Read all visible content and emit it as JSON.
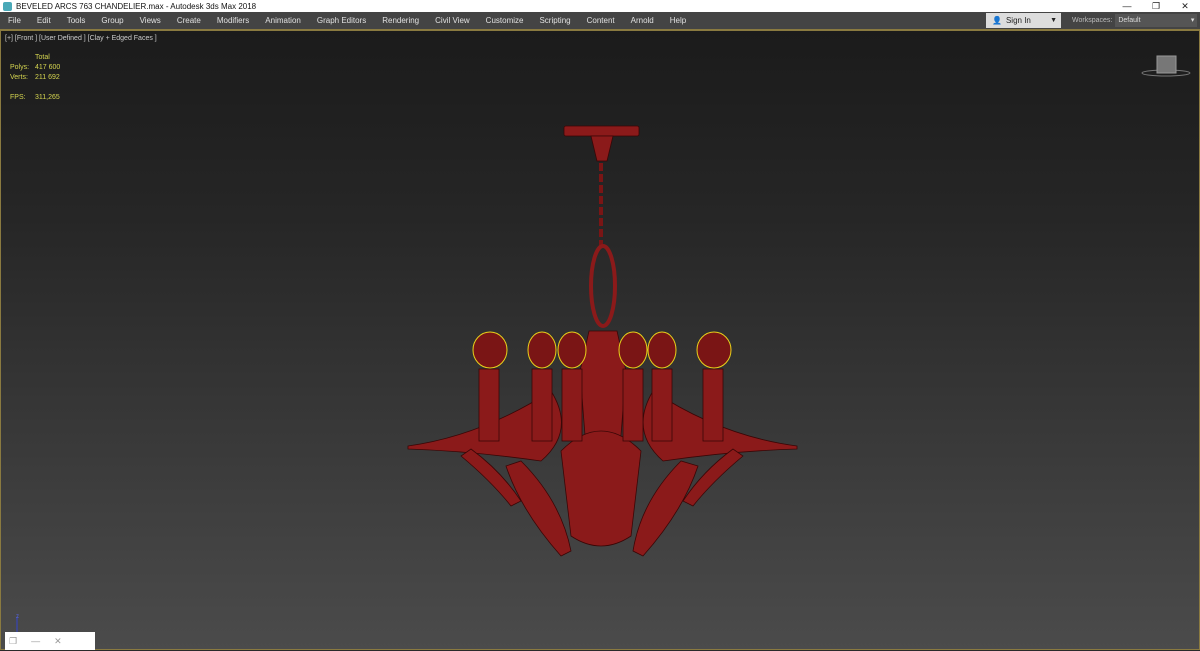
{
  "window": {
    "title": "BEVELED ARCS 763 CHANDELIER.max - Autodesk 3ds Max 2018",
    "minimize": "—",
    "restore": "❐",
    "close": "✕"
  },
  "menu": [
    "File",
    "Edit",
    "Tools",
    "Group",
    "Views",
    "Create",
    "Modifiers",
    "Animation",
    "Graph Editors",
    "Rendering",
    "Civil View",
    "Customize",
    "Scripting",
    "Content",
    "Arnold",
    "Help"
  ],
  "signin": {
    "label": "Sign In",
    "caret": "▼"
  },
  "workspaces": {
    "label": "Workspaces:",
    "value": "Default"
  },
  "viewport": {
    "label": "[+] [Front ] [User Defined ] [Clay + Edged Faces ]",
    "stats": {
      "total_label": "Total",
      "polys_label": "Polys:",
      "polys": "417 600",
      "verts_label": "Verts:",
      "verts": "211 692",
      "fps_label": "FPS:",
      "fps": "311,265"
    },
    "axis_label": "z"
  },
  "colors": {
    "model": "#8b1a1a",
    "wire": "#3a0606",
    "selection": "#e8d21a",
    "stats": "#d6d650"
  }
}
